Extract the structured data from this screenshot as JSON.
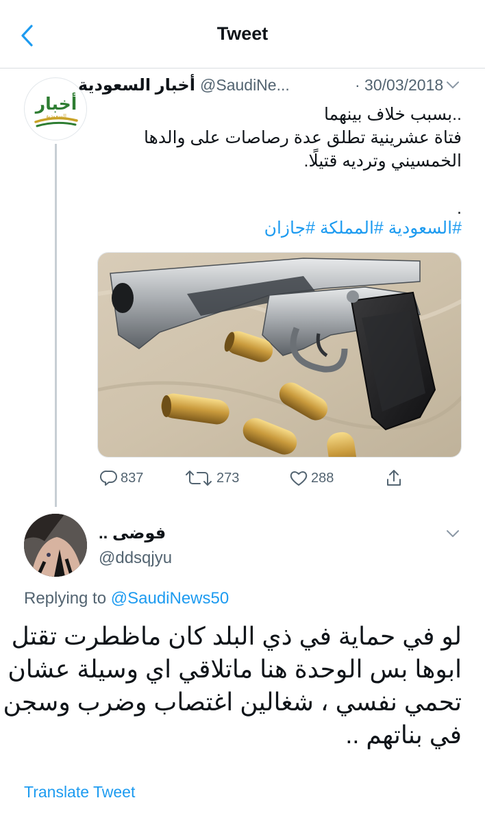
{
  "header": {
    "title": "Tweet"
  },
  "tweet": {
    "author_name": "أخبار السعودية",
    "handle": "@SaudiNe...",
    "date": "· 30/03/2018",
    "avatar_text": "أخبار",
    "avatar_subtext": "السعودية",
    "text_lines": [
      "..بسبب خلاف بينهما",
      "فتاة عشرينية تطلق عدة رصاصات على والدها",
      "الخمسيني وترديه قتيلًا."
    ],
    "trailing_dot": ".",
    "hashtags": [
      "#السعودية",
      "#المملكة",
      "#جازان"
    ],
    "media_icon": "pistol-with-bullets-photo",
    "counts": {
      "replies": "837",
      "retweets": "273",
      "likes": "288"
    }
  },
  "reply": {
    "author_name": "فوضى ..",
    "handle": "@ddsqjyu",
    "replying_prefix": "Replying to",
    "replying_mention": "@SaudiNews50",
    "text_lines": [
      "لو في حماية في ذي البلد كان ماظطرت تقتل",
      "ابوها بس الوحدة هنا ماتلاقي اي وسيلة عشان",
      "تحمي نفسي ، شغالين اغتصاب وضرب وسجن",
      "في بناتهم .."
    ],
    "translate_label": "Translate Tweet"
  },
  "colors": {
    "link": "#1d9bf0",
    "secondary_text": "#536471",
    "logo_green": "#2e7d32",
    "logo_gold": "#c9a227"
  }
}
